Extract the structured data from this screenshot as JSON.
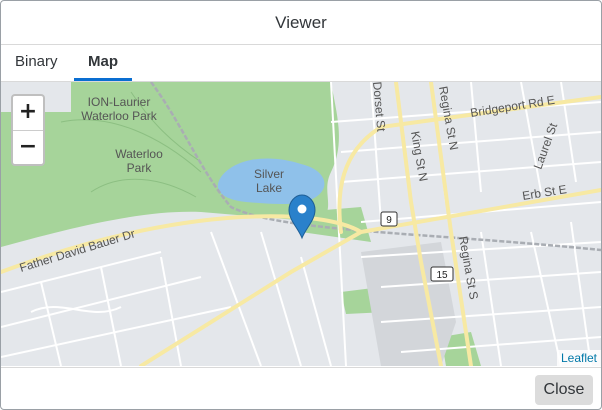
{
  "dialog": {
    "title": "Viewer",
    "close_label": "Close"
  },
  "tabs": [
    {
      "label": "Binary",
      "active": false
    },
    {
      "label": "Map",
      "active": true
    }
  ],
  "map": {
    "zoom_in": "+",
    "zoom_out": "−",
    "attribution": "Leaflet",
    "labels": {
      "ion_laurier": "ION-Laurier",
      "waterloo_park_1": "Waterloo Park",
      "waterloo": "Waterloo",
      "park": "Park",
      "silver": "Silver",
      "lake": "Lake",
      "father_david_bauer": "Father David Bauer Dr",
      "bridgeport": "Bridgeport Rd E",
      "erb": "Erb St E",
      "king": "King St N",
      "regina_n": "Regina St N",
      "regina_s": "Regina St S",
      "laurel": "Laurel St",
      "dorset": "Dorset St",
      "route_9": "9",
      "route_15": "15"
    },
    "colors": {
      "land": "#e4e7eb",
      "park": "#a6d49a",
      "water": "#8fc1ea",
      "major_road": "#f7e9a3",
      "marker": "#2a81cb"
    }
  }
}
